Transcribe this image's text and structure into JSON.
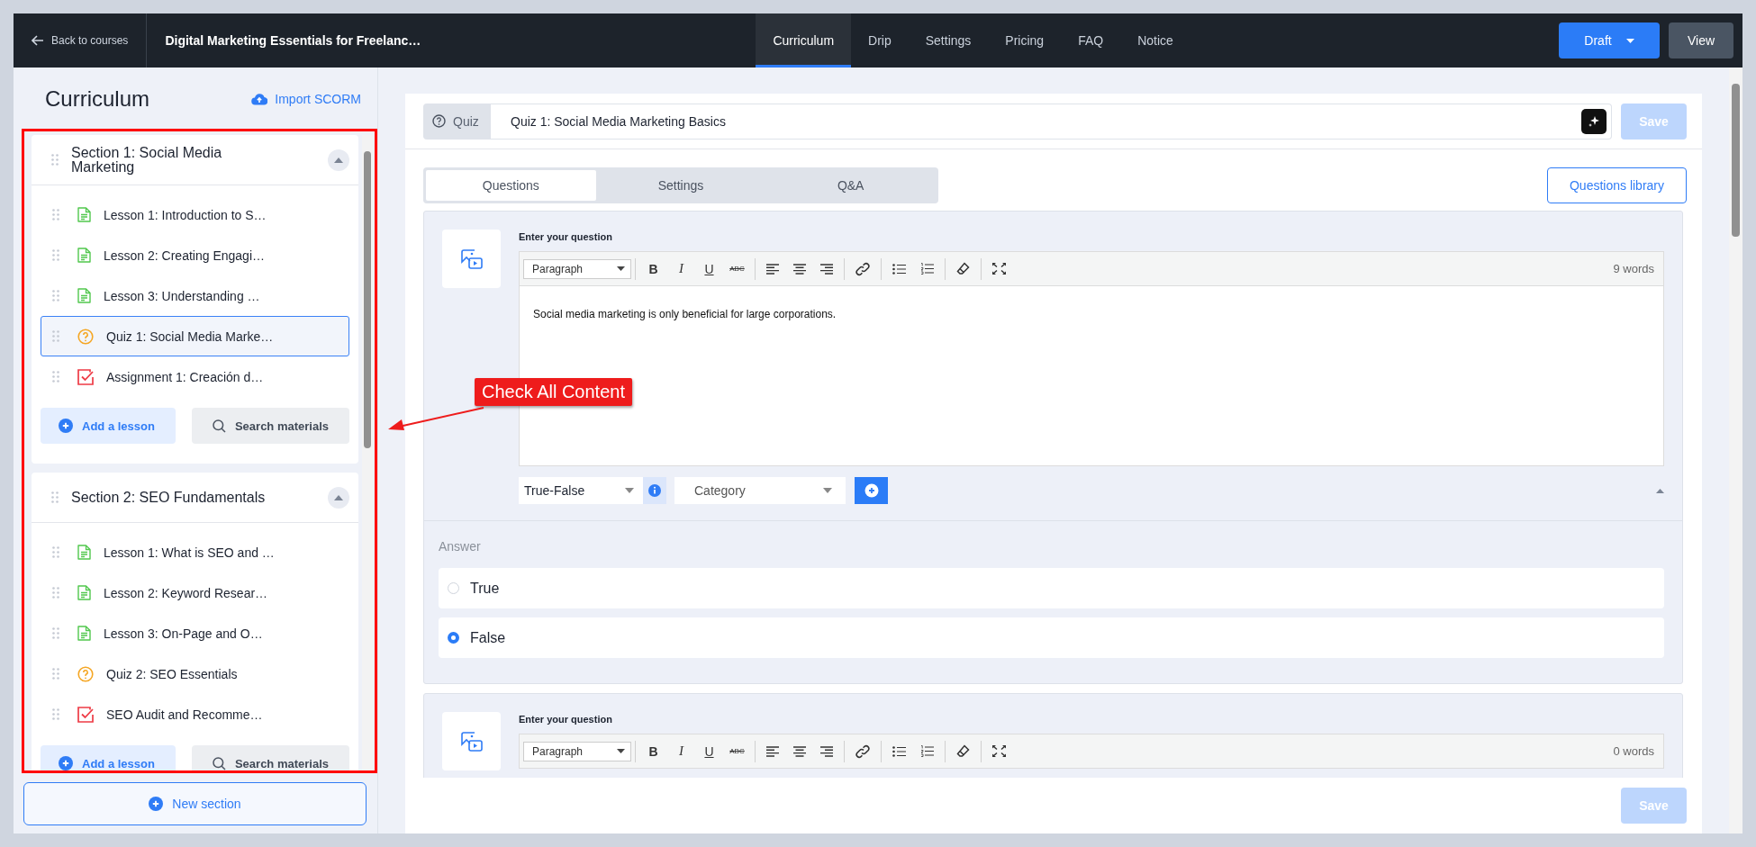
{
  "topbar": {
    "back": "Back to courses",
    "course_title": "Digital Marketing Essentials for Freelanc…",
    "tabs": [
      {
        "label": "Curriculum",
        "selected": true
      },
      {
        "label": "Drip",
        "selected": false
      },
      {
        "label": "Settings",
        "selected": false
      },
      {
        "label": "Pricing",
        "selected": false
      },
      {
        "label": "FAQ",
        "selected": false
      },
      {
        "label": "Notice",
        "selected": false
      }
    ],
    "draft": "Draft",
    "view": "View"
  },
  "sidebar": {
    "title": "Curriculum",
    "import": "Import SCORM",
    "sections": [
      {
        "title": "Section 1: Social Media Marketing",
        "expanded": true,
        "add": "Add a lesson",
        "search": "Search materials",
        "items": [
          {
            "kind": "lesson",
            "title": "Lesson 1: Introduction to S…",
            "selected": false
          },
          {
            "kind": "lesson",
            "title": "Lesson 2: Creating Engagi…",
            "selected": false
          },
          {
            "kind": "lesson",
            "title": "Lesson 3: Understanding …",
            "selected": false
          },
          {
            "kind": "quiz",
            "title": "Quiz 1: Social Media Marke…",
            "selected": true
          },
          {
            "kind": "assignment",
            "title": "Assignment 1: Creación d…",
            "selected": false
          }
        ]
      },
      {
        "title": "Section 2: SEO Fundamentals",
        "expanded": true,
        "add": "Add a lesson",
        "search": "Search materials",
        "items": [
          {
            "kind": "lesson",
            "title": "Lesson 1: What is SEO and …",
            "selected": false
          },
          {
            "kind": "lesson",
            "title": "Lesson 2: Keyword Resear…",
            "selected": false
          },
          {
            "kind": "lesson",
            "title": "Lesson 3: On-Page and O…",
            "selected": false
          },
          {
            "kind": "quiz",
            "title": "Quiz 2: SEO Essentials",
            "selected": false
          },
          {
            "kind": "assignment",
            "title": "SEO Audit and Recomme…",
            "selected": false
          }
        ]
      }
    ],
    "new_section": "New section"
  },
  "annotation": {
    "label": "Check All Content"
  },
  "editor": {
    "type_label": "Quiz",
    "title": "Quiz 1: Social Media Marketing Basics",
    "save": {
      "label": "Save",
      "disabled": true
    },
    "tabs": [
      {
        "label": "Questions",
        "selected": true
      },
      {
        "label": "Settings",
        "selected": false
      },
      {
        "label": "Q&A",
        "selected": false
      }
    ],
    "questions_library": "Questions library",
    "questions": [
      {
        "label": "Enter your question",
        "format": "Paragraph",
        "format_buttons": [
          "B",
          "I",
          "U",
          "ABC"
        ],
        "word_count": "9 words",
        "text": "Social media marketing is only beneficial for large corporations.",
        "type": "True-False",
        "category": "Category",
        "answer_label": "Answer",
        "answers": [
          {
            "label": "True",
            "selected": false
          },
          {
            "label": "False",
            "selected": true
          }
        ]
      },
      {
        "label": "Enter your question",
        "format": "Paragraph",
        "format_buttons": [
          "B",
          "I",
          "U",
          "ABC"
        ],
        "word_count": "0 words"
      }
    ],
    "footer_save": {
      "label": "Save",
      "disabled": true
    }
  }
}
